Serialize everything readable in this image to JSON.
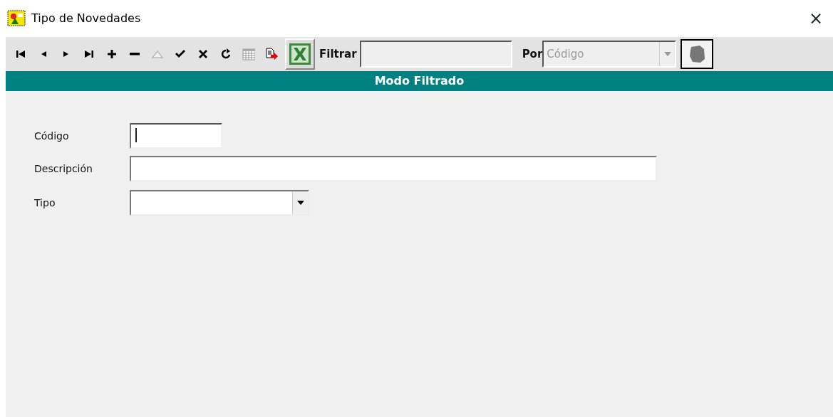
{
  "window": {
    "title": "Tipo de Novedades",
    "close": "×"
  },
  "toolbar": {
    "buttons": [
      {
        "kind": "first",
        "disabled": false
      },
      {
        "kind": "prev",
        "disabled": false
      },
      {
        "kind": "next",
        "disabled": false
      },
      {
        "kind": "last",
        "disabled": false
      },
      {
        "kind": "add",
        "disabled": false
      },
      {
        "kind": "remove",
        "disabled": false
      },
      {
        "kind": "edit",
        "disabled": true
      },
      {
        "kind": "confirm",
        "disabled": false
      },
      {
        "kind": "cancel",
        "disabled": false
      },
      {
        "kind": "refresh",
        "disabled": false
      },
      {
        "kind": "grid",
        "disabled": false
      },
      {
        "kind": "export",
        "disabled": false
      },
      {
        "kind": "excel",
        "disabled": false
      }
    ],
    "filter_label": "Filtrar",
    "by_label": "Por",
    "by_value": "Código",
    "by_disabled": true
  },
  "mode_banner": "Modo Filtrado",
  "form": {
    "fields": [
      {
        "label": "Código",
        "kind": "text",
        "focused": true
      },
      {
        "label": "Descripción",
        "kind": "text",
        "focused": false
      },
      {
        "label": "Tipo",
        "kind": "combo",
        "focused": false
      }
    ]
  }
}
